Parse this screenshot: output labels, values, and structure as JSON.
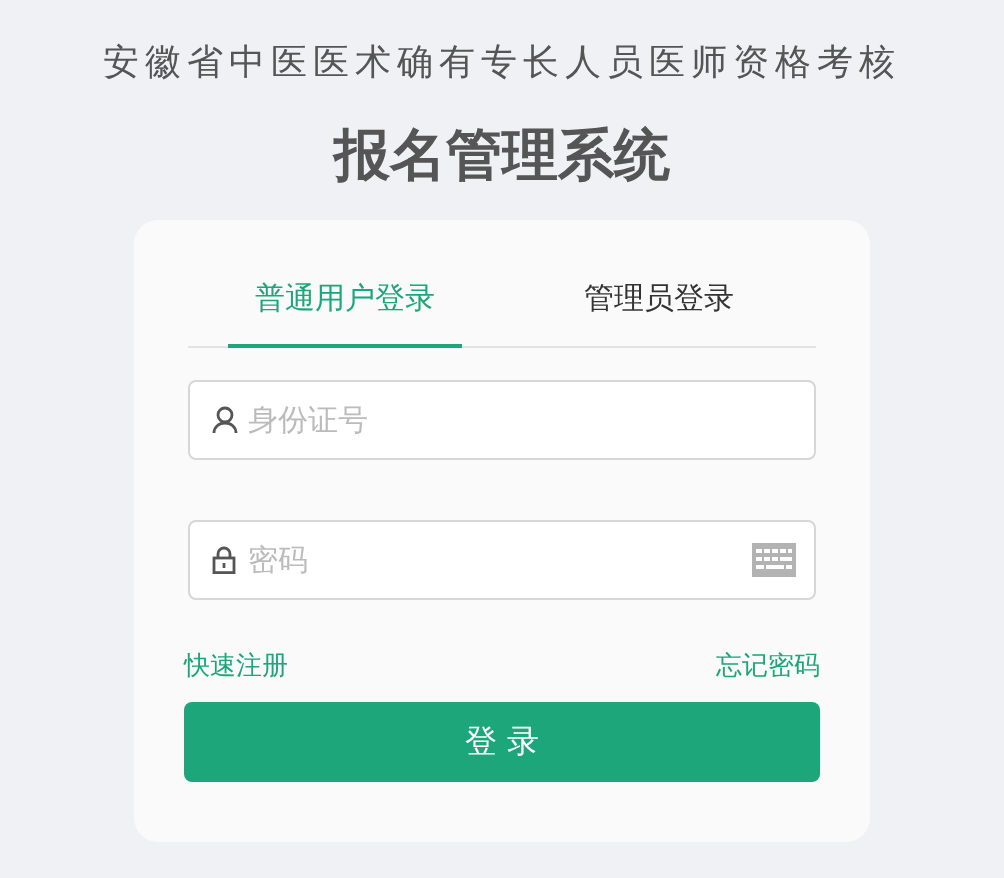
{
  "subtitle": "安徽省中医医术确有专长人员医师资格考核",
  "title": "报名管理系统",
  "tabs": [
    {
      "label": "普通用户登录",
      "selected": true
    },
    {
      "label": "管理员登录",
      "selected": false
    }
  ],
  "fields": [
    {
      "kind": "user",
      "placeholder": "身份证号"
    },
    {
      "kind": "password",
      "placeholder": "密码"
    }
  ],
  "links": [
    "快速注册",
    "忘记密码"
  ],
  "login_button": "登 录"
}
